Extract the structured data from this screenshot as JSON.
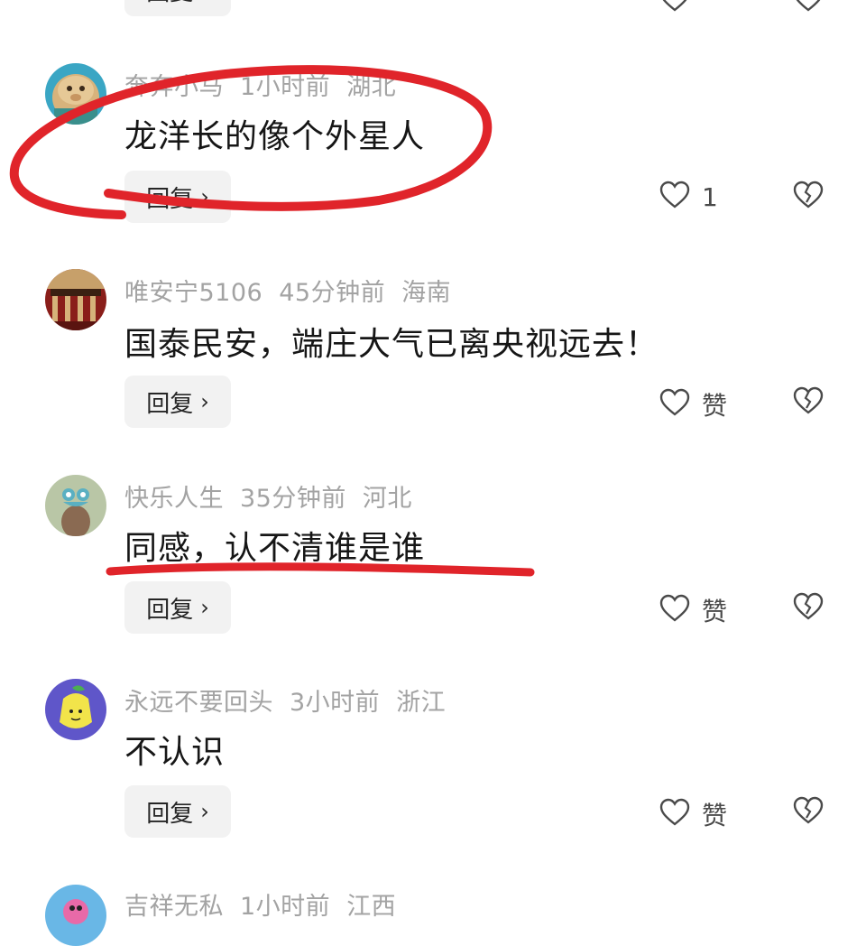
{
  "comments": [
    {
      "username": "",
      "time": "",
      "location": "",
      "text": "",
      "reply_label": "回复",
      "like_label": "",
      "partial": "top"
    },
    {
      "username": "奔奔小马",
      "time": "1小时前",
      "location": "湖北",
      "text": "龙洋长的像个外星人",
      "reply_label": "回复",
      "like_label": "1"
    },
    {
      "username": "唯安宁5106",
      "time": "45分钟前",
      "location": "海南",
      "text": "国泰民安，端庄大气已离央视远去！",
      "reply_label": "回复",
      "like_label": "赞"
    },
    {
      "username": "快乐人生",
      "time": "35分钟前",
      "location": "河北",
      "text": "同感，认不清谁是谁",
      "reply_label": "回复",
      "like_label": "赞"
    },
    {
      "username": "永远不要回头",
      "time": "3小时前",
      "location": "浙江",
      "text": "不认识",
      "reply_label": "回复",
      "like_label": "赞"
    },
    {
      "username": "吉祥无私",
      "time": "1小时前",
      "location": "江西",
      "text": "",
      "reply_label": "",
      "like_label": "",
      "partial": "bottom"
    }
  ],
  "icons": {
    "like": "heart-outline-icon",
    "dislike": "broken-heart-icon",
    "reply_arrow": "chevron-right-icon"
  },
  "colors": {
    "annotation_red": "#e0242a",
    "meta_gray": "#a3a3a3",
    "reply_bg": "#f2f2f2"
  }
}
